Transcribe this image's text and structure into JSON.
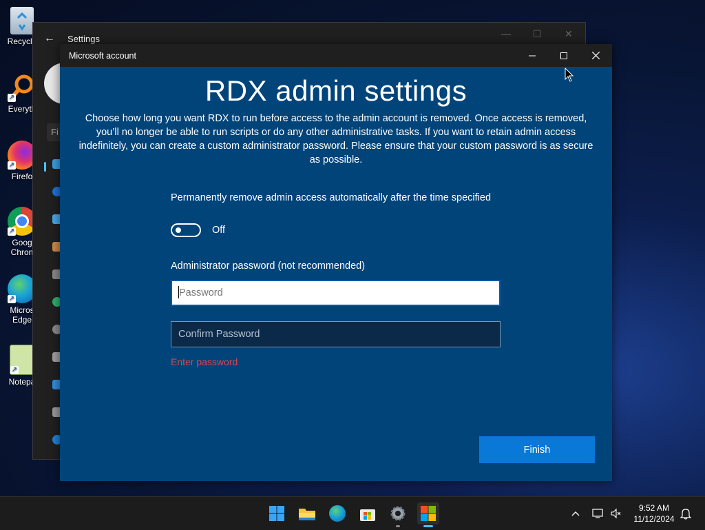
{
  "desktop": {
    "icons": [
      {
        "label": "Recycle",
        "icon": "recycle-bin-icon"
      },
      {
        "label": "Everyth",
        "icon": "everything-search-icon"
      },
      {
        "label": "Firefo",
        "icon": "firefox-icon"
      },
      {
        "label": "Goog Chron",
        "icon": "chrome-icon"
      },
      {
        "label": "Micros Edge",
        "icon": "edge-icon"
      },
      {
        "label": "Notepa",
        "icon": "notepad-icon"
      }
    ]
  },
  "settings_window": {
    "title": "Settings",
    "search_stub": "Fi"
  },
  "dialog": {
    "title": "Microsoft account",
    "heading": "RDX admin settings",
    "description": "Choose how long you want RDX to run before access to the admin account is removed. Once access is removed, you’ll no longer be able to run scripts or do any other administrative tasks. If you want to retain admin access indefinitely, you can create a custom administrator password. Please ensure that your custom password is as secure as possible.",
    "toggle_label": "Permanently remove admin access automatically after the time specified",
    "toggle_state": "Off",
    "password_label": "Administrator password (not recommended)",
    "password_placeholder": "Password",
    "confirm_placeholder": "Confirm Password",
    "error_text": "Enter password",
    "finish_label": "Finish"
  },
  "taskbar": {
    "apps": [
      "start-icon",
      "file-explorer-icon",
      "edge-icon",
      "microsoft-store-icon",
      "settings-gear-icon",
      "microsoft-logo-icon"
    ],
    "clock_time": "9:52 AM",
    "clock_date": "11/12/2024"
  },
  "colors": {
    "dialog_bg": "#01447a",
    "accent": "#0a78d6",
    "error": "#e0434d"
  }
}
